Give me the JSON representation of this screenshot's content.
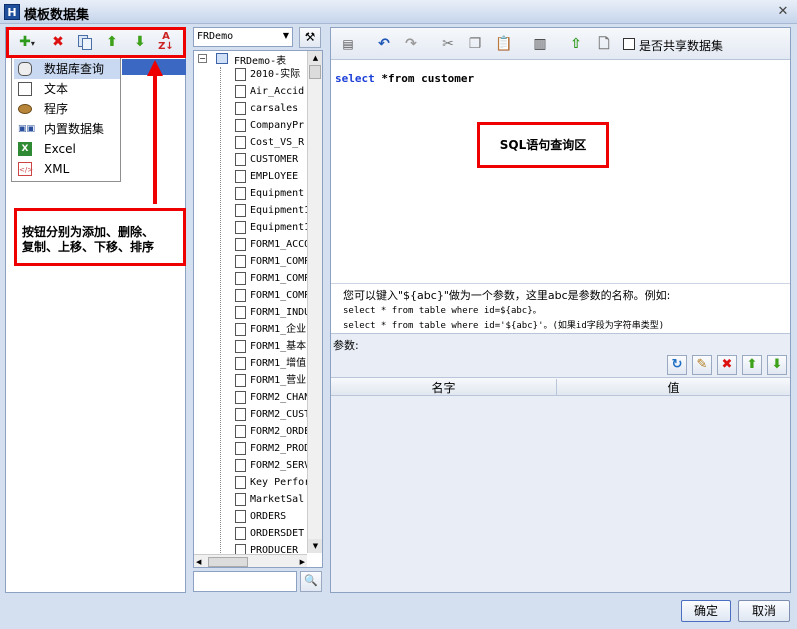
{
  "window": {
    "title": "模板数据集",
    "icon": "app-logo-icon"
  },
  "left_panel": {
    "toolbar": {
      "add_icon": "plus-dropdown-icon",
      "delete_icon": "red-x-icon",
      "copy_icon": "copy-icon",
      "up_icon": "up-arrow-icon",
      "down_icon": "down-arrow-icon",
      "sort_icon": "sort-az-icon"
    },
    "menu_items": [
      {
        "label": "数据库查询",
        "icon": "database-icon"
      },
      {
        "label": "文本",
        "icon": "text-file-icon"
      },
      {
        "label": "程序",
        "icon": "program-icon"
      },
      {
        "label": "内置数据集",
        "icon": "builtin-dataset-icon"
      },
      {
        "label": "Excel",
        "icon": "excel-icon"
      },
      {
        "label": "XML",
        "icon": "xml-icon"
      }
    ],
    "callout_line1": "按钮分别为添加、删除、",
    "callout_line2": "复制、上移、下移、排序"
  },
  "middle_panel": {
    "datasource": "FRDemo",
    "tree_root": "FRDemo-表",
    "tables": [
      "2010-实际",
      "Air_Accid",
      "carsales",
      "CompanyPr",
      "Cost_VS_R",
      "CUSTOMER",
      "EMPLOYEE",
      "Equipment",
      "Equipment1",
      "Equipment1",
      "FORM1_ACCO",
      "FORM1_COMP",
      "FORM1_COMP",
      "FORM1_COMP",
      "FORM1_INDU",
      "FORM1_企业",
      "FORM1_基本",
      "FORM1_增值",
      "FORM1_营业",
      "FORM2_CHAN",
      "FORM2_CUST",
      "FORM2_ORDE",
      "FORM2_PROD",
      "FORM2_SERV",
      "Key Perfor",
      "MarketSal",
      "ORDERS",
      "ORDERSDET",
      "PRODUCER"
    ]
  },
  "right_panel": {
    "toolbar": {
      "share_checkbox_label": "是否共享数据集"
    },
    "sql": {
      "keyword": "select",
      "rest": " *from customer"
    },
    "sql_callout": "SQL语句查询区",
    "hint_line1": "您可以键入\"${abc}\"做为一个参数，这里abc是参数的名称。例如:",
    "hint_line2": "select * from table where id=${abc}。",
    "hint_line3": "select * from table where id='${abc}'。(如果id字段为字符串类型)",
    "params_label": "参数:",
    "columns": {
      "name": "名字",
      "value": "值"
    }
  },
  "footer": {
    "ok": "确定",
    "cancel": "取消"
  }
}
